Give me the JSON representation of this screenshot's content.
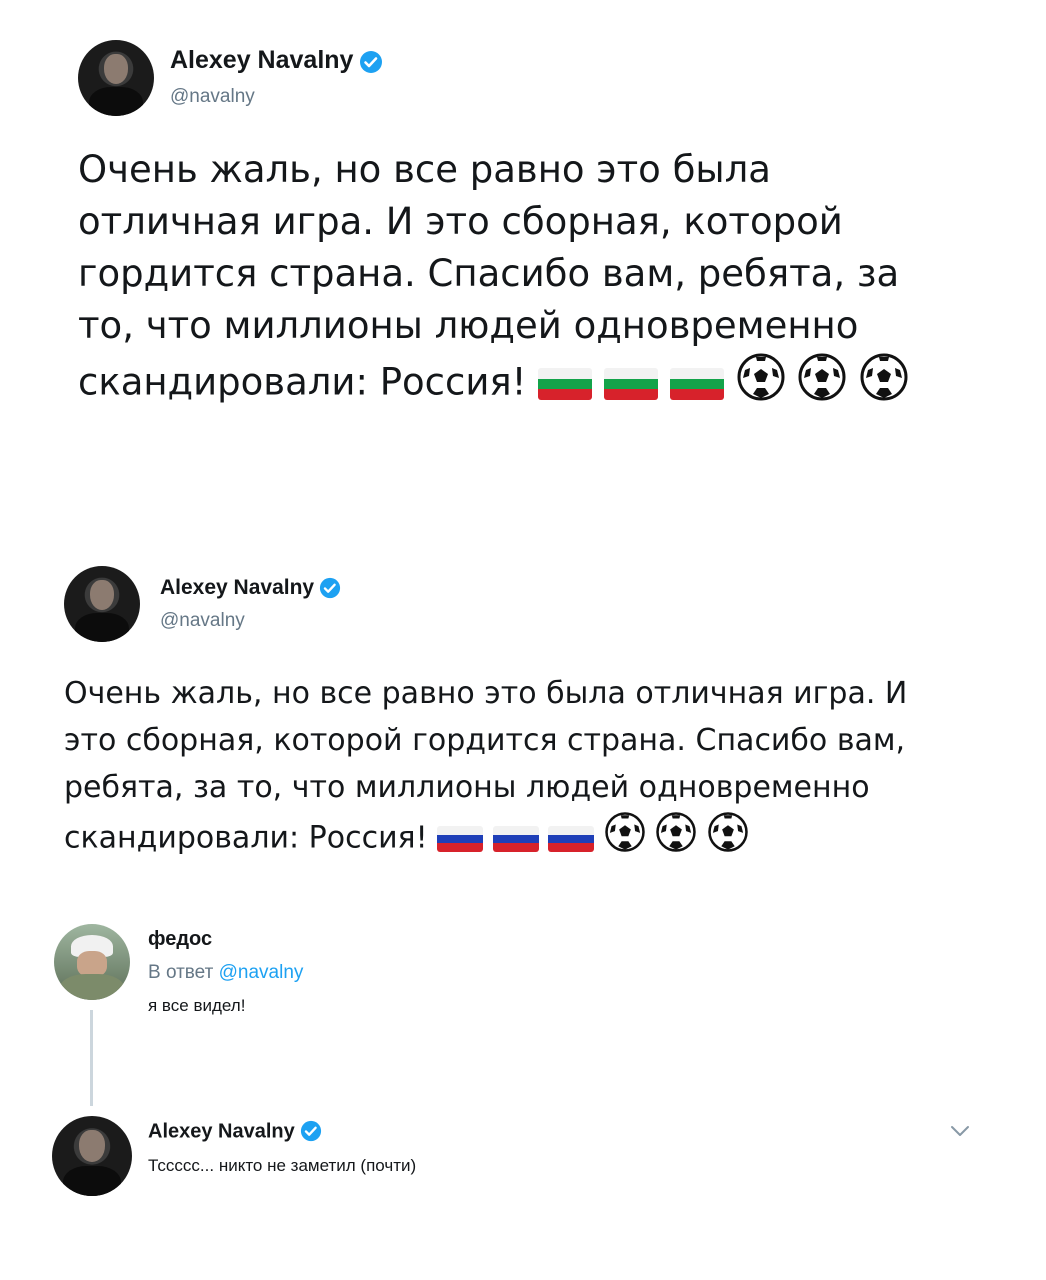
{
  "tweet_top": {
    "author_name": "Alexey Navalny",
    "author_handle": "@navalny",
    "text": "Очень жаль, но все равно это была отличная игра. И это сборная, которой гордится страна. Спасибо вам, ребята, за то, что миллионы людей одновременно скандировали: Россия!",
    "flag_colors": [
      "#f2f2f2",
      "#13a34a",
      "#d7222b"
    ],
    "emoji": [
      "flag",
      "flag",
      "flag",
      "soccer-ball",
      "soccer-ball",
      "soccer-ball"
    ]
  },
  "tweet_middle": {
    "author_name": "Alexey Navalny",
    "author_handle": "@navalny",
    "text": "Очень жаль, но все равно это была отличная игра. И это сборная, которой гордится страна. Спасибо вам, ребята, за то, что миллионы людей одновременно скандировали: Россия!",
    "flag_colors": [
      "#f2f2f2",
      "#1f3fb8",
      "#d7222b"
    ],
    "emoji": [
      "flag",
      "flag",
      "flag",
      "soccer-ball",
      "soccer-ball",
      "soccer-ball"
    ]
  },
  "reply": {
    "author_name": "федос",
    "reply_prefix": "В ответ",
    "reply_to": "@navalny",
    "text": "я все видел!"
  },
  "answer": {
    "author_name": "Alexey Navalny",
    "text": "Тссссс... никто не заметил (почти)",
    "menu_icon": "chevron-down-icon"
  },
  "colors": {
    "verified": "#1da1f2",
    "link": "#1da1f2",
    "muted": "#657786"
  }
}
